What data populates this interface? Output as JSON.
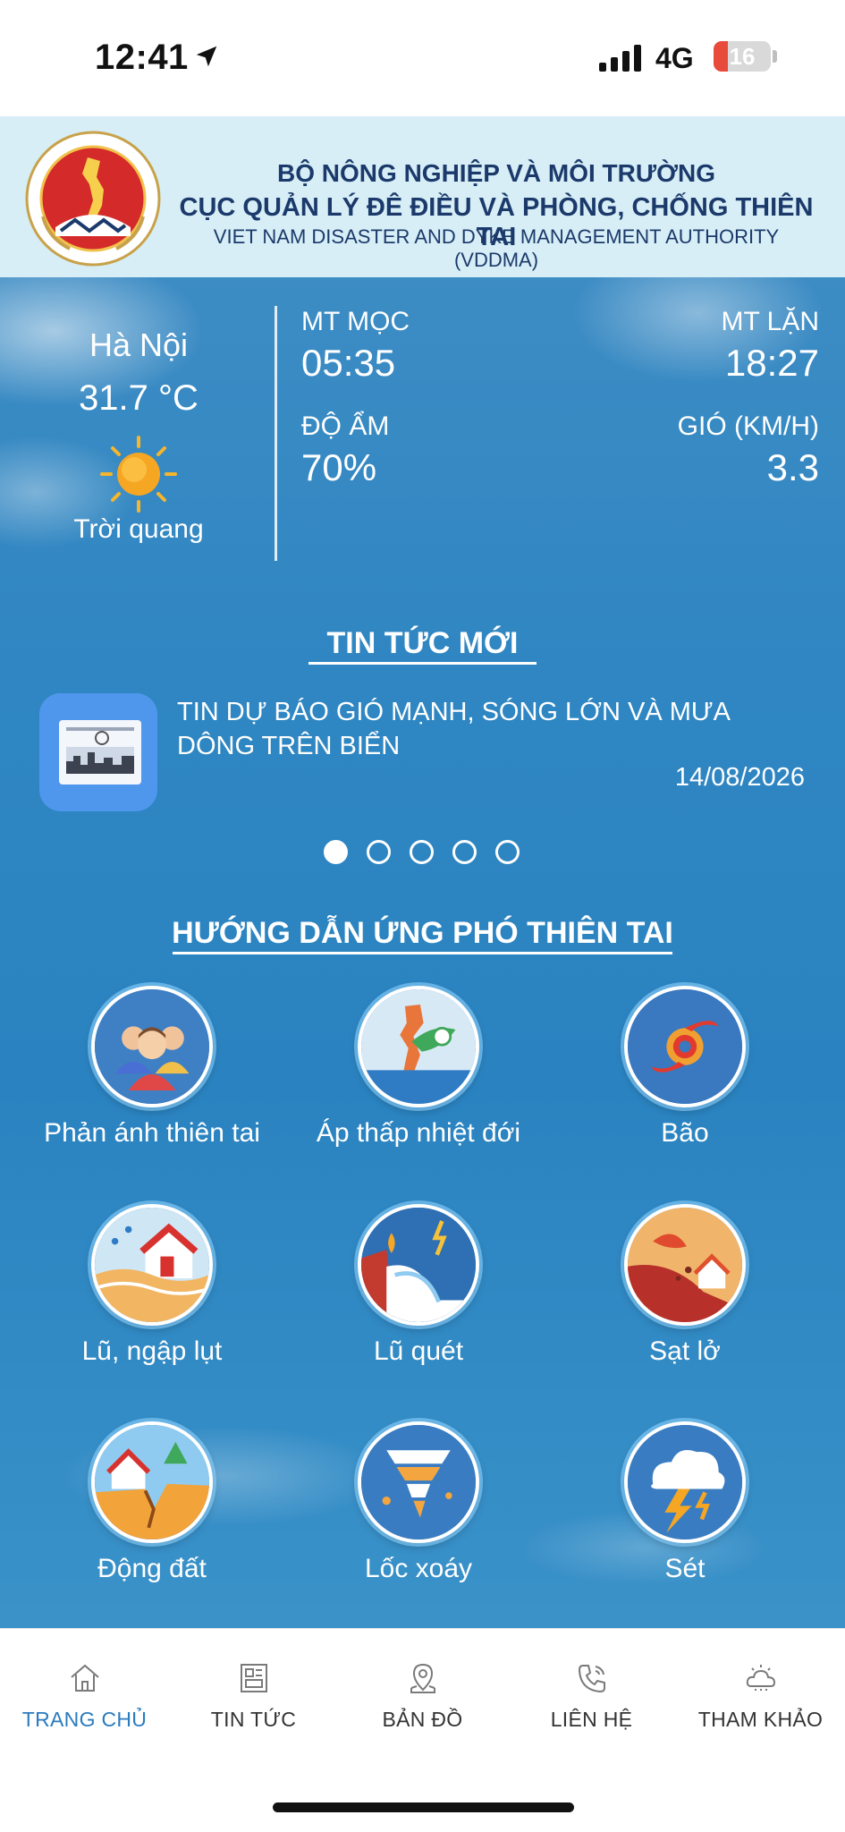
{
  "status_bar": {
    "time": "12:41",
    "network": "4G",
    "battery": "16"
  },
  "header": {
    "line1": "BỘ NÔNG NGHIỆP VÀ MÔI TRƯỜNG",
    "line2": "CỤC QUẢN LÝ ĐÊ ĐIỀU VÀ PHÒNG, CHỐNG THIÊN TAI",
    "line3": "VIET NAM DISASTER AND DYKE MANAGEMENT AUTHORITY (VDDMA)"
  },
  "weather": {
    "city": "Hà Nội",
    "temperature": "31.7 °C",
    "condition": "Trời quang",
    "sunrise_label": "MT MỌC",
    "sunrise": "05:35",
    "sunset_label": "MT LẶN",
    "sunset": "18:27",
    "humidity_label": "ĐỘ ẨM",
    "humidity": "70%",
    "wind_label": "GIÓ (KM/H)",
    "wind": "3.3"
  },
  "news": {
    "section_title": "TIN TỨC MỚI",
    "item": {
      "title": "TIN DỰ BÁO GIÓ MẠNH, SÓNG LỚN VÀ MƯA DÔNG TRÊN BIỂN",
      "date": "14/08/2026"
    },
    "pages": 5,
    "active_page": 1
  },
  "guide": {
    "section_title": "HƯỚNG DẪN ỨNG PHÓ THIÊN TAI",
    "items": [
      {
        "label": "Phản ánh thiên tai",
        "icon": "people-report-icon"
      },
      {
        "label": "Áp thấp nhiệt đới",
        "icon": "tropical-depression-icon"
      },
      {
        "label": "Bão",
        "icon": "storm-icon"
      },
      {
        "label": "Lũ, ngập lụt",
        "icon": "flood-icon"
      },
      {
        "label": "Lũ quét",
        "icon": "flash-flood-icon"
      },
      {
        "label": "Sạt lở",
        "icon": "landslide-icon"
      },
      {
        "label": "Động đất",
        "icon": "earthquake-icon"
      },
      {
        "label": "Lốc xoáy",
        "icon": "tornado-icon"
      },
      {
        "label": "Sét",
        "icon": "lightning-icon"
      }
    ]
  },
  "bottom_nav": [
    {
      "label": "TRANG CHỦ",
      "icon": "home-icon",
      "active": true
    },
    {
      "label": "TIN TỨC",
      "icon": "news-icon",
      "active": false
    },
    {
      "label": "BẢN ĐỒ",
      "icon": "map-pin-icon",
      "active": false
    },
    {
      "label": "LIÊN HỆ",
      "icon": "phone-icon",
      "active": false
    },
    {
      "label": "THAM KHẢO",
      "icon": "weather-cloud-icon",
      "active": false
    }
  ],
  "colors": {
    "header_bg": "#d7eef6",
    "header_text": "#1b3a6b",
    "sky": "#2f86c2",
    "nav_active": "#2a7bbf"
  }
}
